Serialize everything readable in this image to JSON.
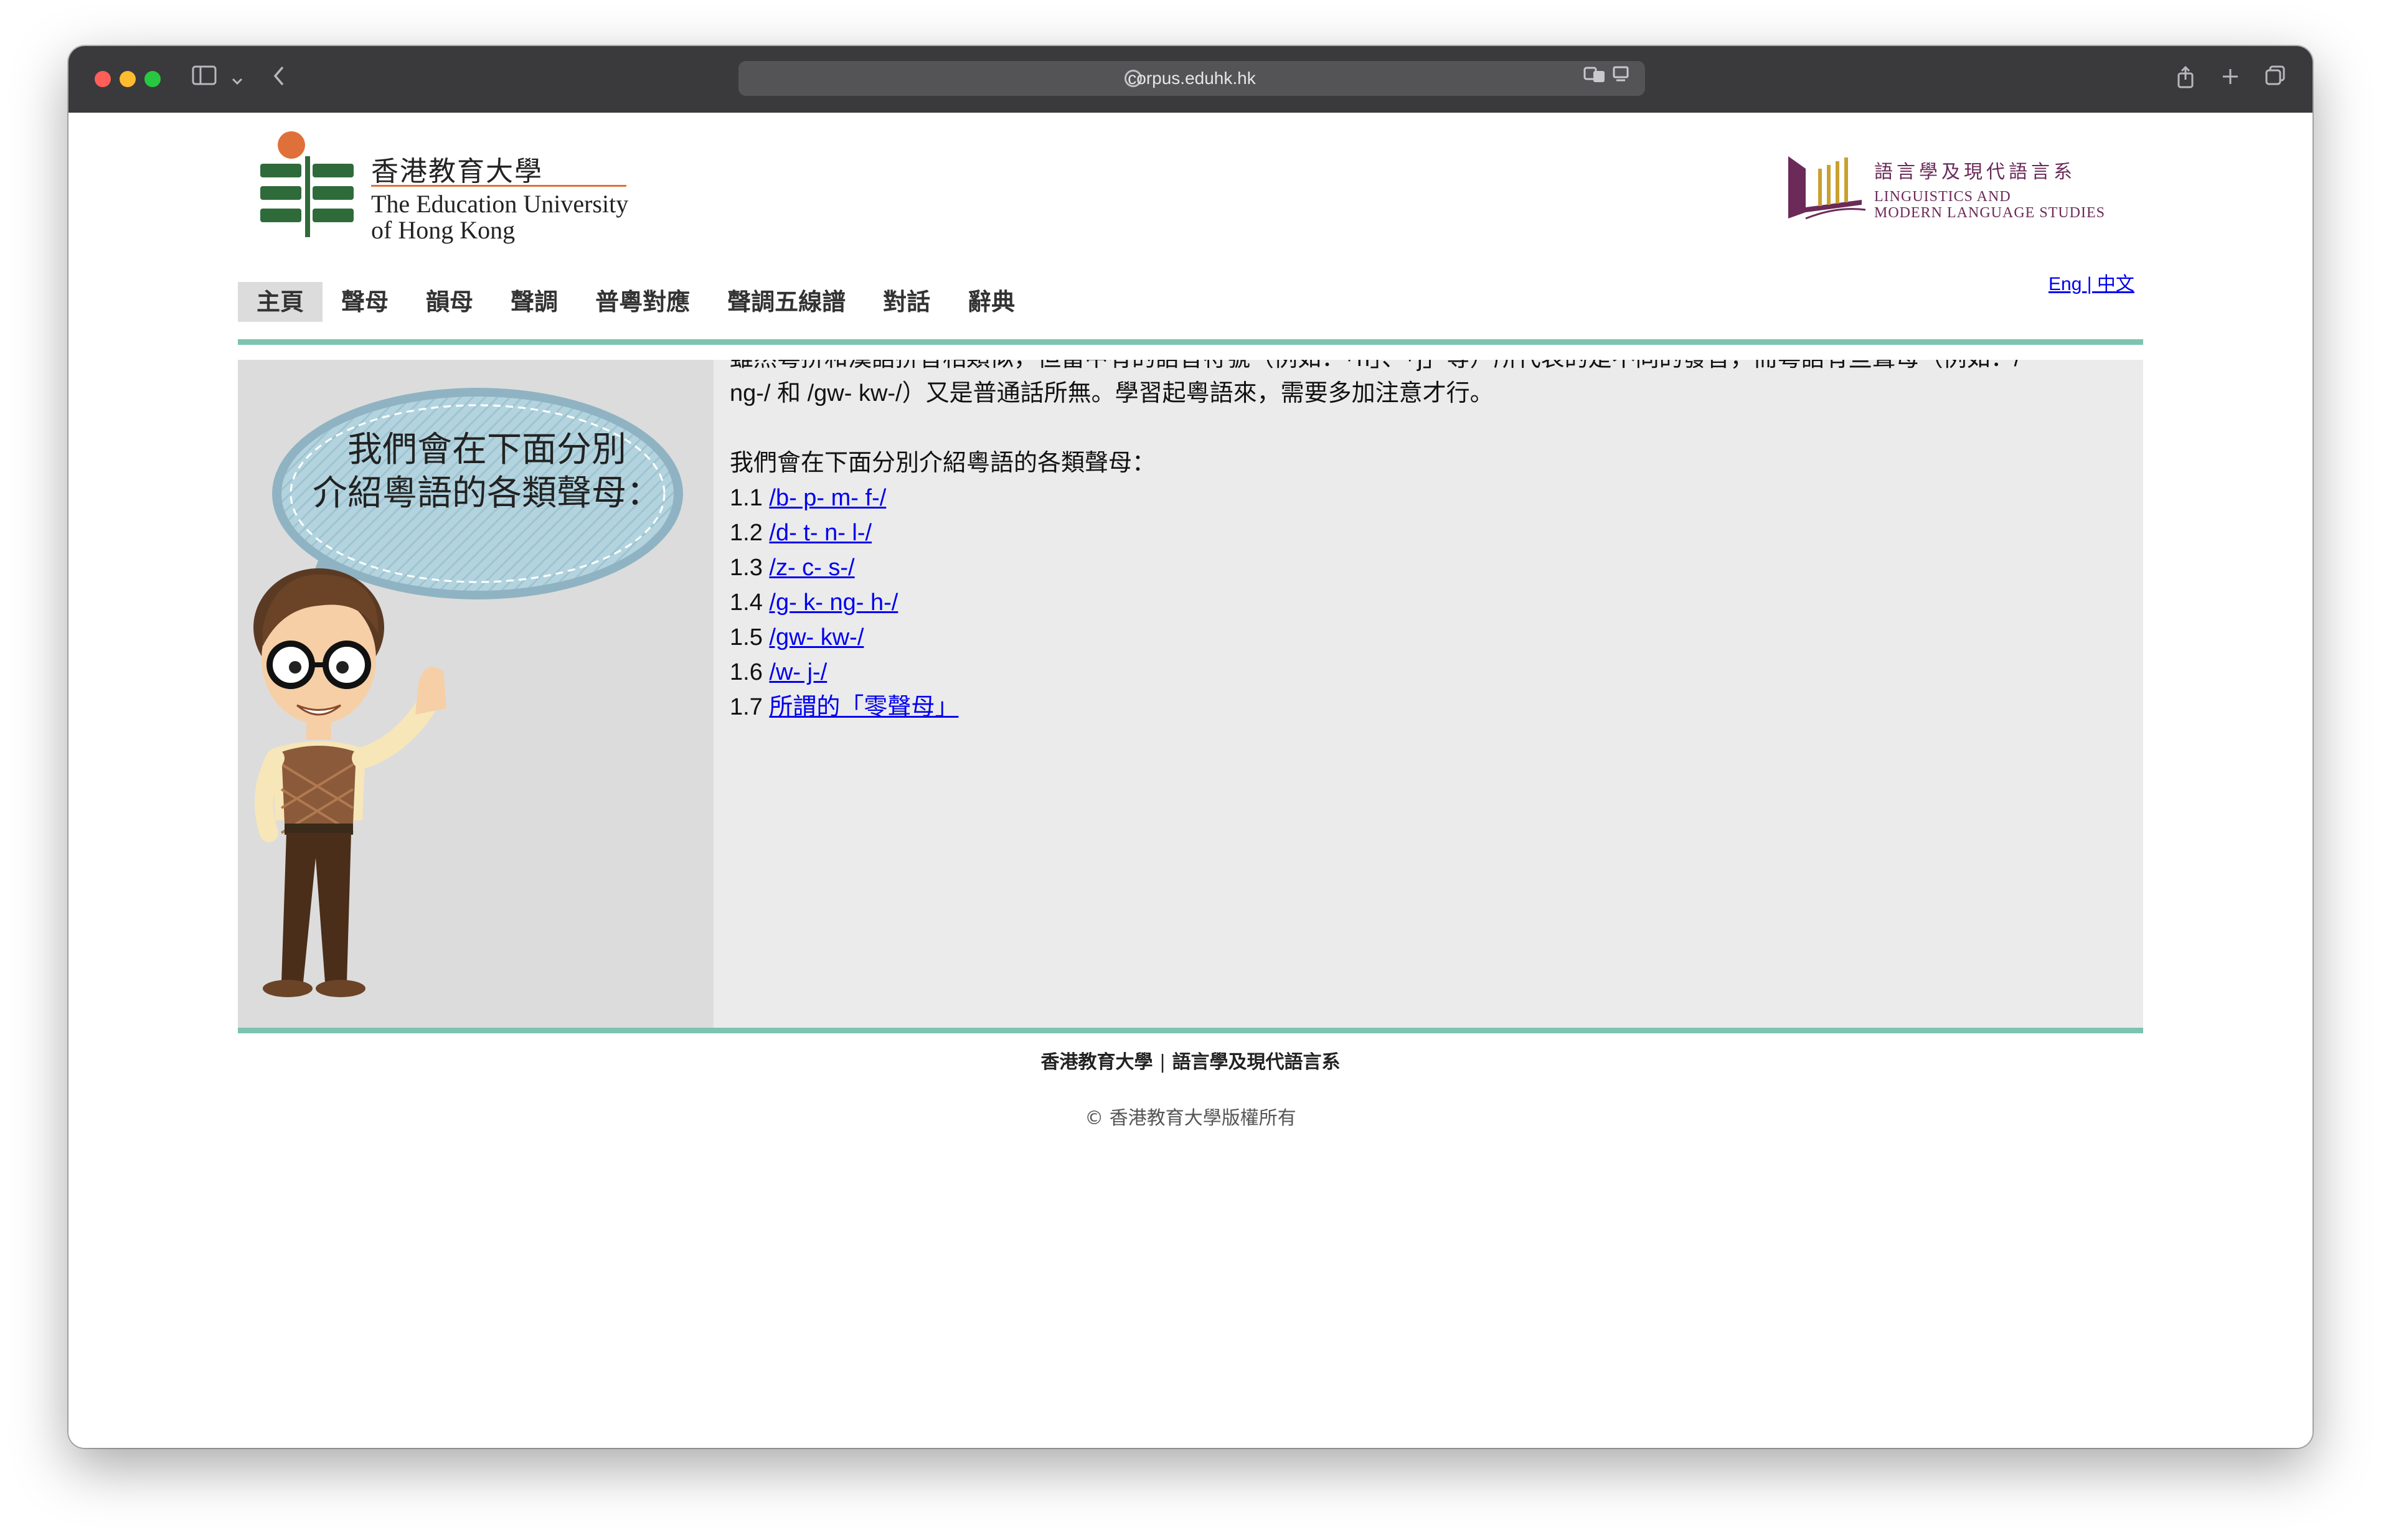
{
  "browser": {
    "url": "corpus.eduhk.hk"
  },
  "header": {
    "logo": {
      "cn": "香港教育大學",
      "en_line1": "The Education University",
      "en_line2": "of Hong Kong"
    },
    "dept_logo": {
      "cn": "語言學及現代語言系",
      "en_line1": "LINGUISTICS AND",
      "en_line2": "MODERN LANGUAGE STUDIES"
    },
    "lang_switch": "Eng | 中文"
  },
  "nav": {
    "items": [
      {
        "label": "主頁"
      },
      {
        "label": "聲母"
      },
      {
        "label": "韻母"
      },
      {
        "label": "聲調"
      },
      {
        "label": "普粵對應"
      },
      {
        "label": "聲調五線譜"
      },
      {
        "label": "對話"
      },
      {
        "label": "辭典"
      }
    ]
  },
  "aside": {
    "bubble_line1": "我們會在下面分別",
    "bubble_line2": "介紹粵語的各類聲母："
  },
  "main": {
    "intro_line1": "雖然粵拼和漢語拼音相類似，但當中有的語音符號（例如：「n」、「j」等）所代表的是不同的發音，而粵語有些聲母（例如：/",
    "intro_line2": "ng-/ 和 /gw- kw-/）又是普通話所無。學習起粵語來，需要多加注意才行。",
    "lead": "我們會在下面分別介紹粵語的各類聲母：",
    "items": [
      {
        "num": "1.1",
        "link": "/b- p- m- f-/"
      },
      {
        "num": "1.2",
        "link": "/d- t- n- l-/"
      },
      {
        "num": "1.3",
        "link": "/z- c- s-/"
      },
      {
        "num": "1.4",
        "link": "/g- k- ng- h-/"
      },
      {
        "num": "1.5",
        "link": "/gw- kw-/"
      },
      {
        "num": "1.6",
        "link": "/w- j-/"
      },
      {
        "num": "1.7",
        "link": "所謂的「零聲母」"
      }
    ]
  },
  "footer": {
    "org": "香港教育大學",
    "sep": "|",
    "dept": "語言學及現代語言系",
    "copyright": "© 香港教育大學版權所有"
  },
  "colors": {
    "accent_rule": "#7cc4b1",
    "link": "#0000ee",
    "logo_green": "#2f6b3a",
    "logo_orange": "#e0703a",
    "dept_purple": "#6b2a58",
    "dept_gold": "#c9a030"
  },
  "icons": {
    "sidebar": "sidebar-icon",
    "back": "back-chevron-icon",
    "site": "globe-icon",
    "translate": "translate-icon",
    "reader": "reader-icon",
    "share": "share-icon",
    "new_tab": "plus-icon",
    "tabs": "tabs-overview-icon"
  }
}
